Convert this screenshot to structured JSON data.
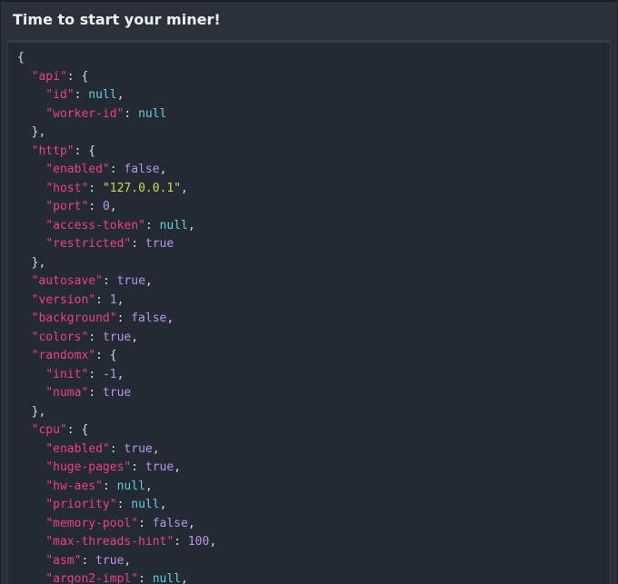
{
  "panel": {
    "title": "Time to start your miner!"
  },
  "colors": {
    "key": "#ef3f86",
    "punctuation": "#d7dce2",
    "null": "#5fd0e6",
    "boolean": "#b994f0",
    "number": "#b994f0",
    "string": "#c7e04a",
    "panel_bg": "#2a313b",
    "code_bg": "#242a33"
  },
  "config_json": {
    "lines": [
      {
        "indent": 0,
        "tokens": [
          {
            "t": "punc",
            "v": "{"
          }
        ]
      },
      {
        "indent": 1,
        "tokens": [
          {
            "t": "key",
            "v": "\"api\""
          },
          {
            "t": "punc",
            "v": ": {"
          }
        ]
      },
      {
        "indent": 2,
        "tokens": [
          {
            "t": "key",
            "v": "\"id\""
          },
          {
            "t": "punc",
            "v": ": "
          },
          {
            "t": "null",
            "v": "null"
          },
          {
            "t": "punc",
            "v": ","
          }
        ]
      },
      {
        "indent": 2,
        "tokens": [
          {
            "t": "key",
            "v": "\"worker-id\""
          },
          {
            "t": "punc",
            "v": ": "
          },
          {
            "t": "null",
            "v": "null"
          }
        ]
      },
      {
        "indent": 1,
        "tokens": [
          {
            "t": "punc",
            "v": "},"
          }
        ]
      },
      {
        "indent": 1,
        "tokens": [
          {
            "t": "key",
            "v": "\"http\""
          },
          {
            "t": "punc",
            "v": ": {"
          }
        ]
      },
      {
        "indent": 2,
        "tokens": [
          {
            "t": "key",
            "v": "\"enabled\""
          },
          {
            "t": "punc",
            "v": ": "
          },
          {
            "t": "bool",
            "v": "false"
          },
          {
            "t": "punc",
            "v": ","
          }
        ]
      },
      {
        "indent": 2,
        "tokens": [
          {
            "t": "key",
            "v": "\"host\""
          },
          {
            "t": "punc",
            "v": ": "
          },
          {
            "t": "str",
            "v": "\"127.0.0.1\""
          },
          {
            "t": "punc",
            "v": ","
          }
        ]
      },
      {
        "indent": 2,
        "tokens": [
          {
            "t": "key",
            "v": "\"port\""
          },
          {
            "t": "punc",
            "v": ": "
          },
          {
            "t": "num",
            "v": "0"
          },
          {
            "t": "punc",
            "v": ","
          }
        ]
      },
      {
        "indent": 2,
        "tokens": [
          {
            "t": "key",
            "v": "\"access-token\""
          },
          {
            "t": "punc",
            "v": ": "
          },
          {
            "t": "null",
            "v": "null"
          },
          {
            "t": "punc",
            "v": ","
          }
        ]
      },
      {
        "indent": 2,
        "tokens": [
          {
            "t": "key",
            "v": "\"restricted\""
          },
          {
            "t": "punc",
            "v": ": "
          },
          {
            "t": "bool",
            "v": "true"
          }
        ]
      },
      {
        "indent": 1,
        "tokens": [
          {
            "t": "punc",
            "v": "},"
          }
        ]
      },
      {
        "indent": 1,
        "tokens": [
          {
            "t": "key",
            "v": "\"autosave\""
          },
          {
            "t": "punc",
            "v": ": "
          },
          {
            "t": "bool",
            "v": "true"
          },
          {
            "t": "punc",
            "v": ","
          }
        ]
      },
      {
        "indent": 1,
        "tokens": [
          {
            "t": "key",
            "v": "\"version\""
          },
          {
            "t": "punc",
            "v": ": "
          },
          {
            "t": "num",
            "v": "1"
          },
          {
            "t": "punc",
            "v": ","
          }
        ]
      },
      {
        "indent": 1,
        "tokens": [
          {
            "t": "key",
            "v": "\"background\""
          },
          {
            "t": "punc",
            "v": ": "
          },
          {
            "t": "bool",
            "v": "false"
          },
          {
            "t": "punc",
            "v": ","
          }
        ]
      },
      {
        "indent": 1,
        "tokens": [
          {
            "t": "key",
            "v": "\"colors\""
          },
          {
            "t": "punc",
            "v": ": "
          },
          {
            "t": "bool",
            "v": "true"
          },
          {
            "t": "punc",
            "v": ","
          }
        ]
      },
      {
        "indent": 1,
        "tokens": [
          {
            "t": "key",
            "v": "\"randomx\""
          },
          {
            "t": "punc",
            "v": ": {"
          }
        ]
      },
      {
        "indent": 2,
        "tokens": [
          {
            "t": "key",
            "v": "\"init\""
          },
          {
            "t": "punc",
            "v": ": "
          },
          {
            "t": "num",
            "v": "-1"
          },
          {
            "t": "punc",
            "v": ","
          }
        ]
      },
      {
        "indent": 2,
        "tokens": [
          {
            "t": "key",
            "v": "\"numa\""
          },
          {
            "t": "punc",
            "v": ": "
          },
          {
            "t": "bool",
            "v": "true"
          }
        ]
      },
      {
        "indent": 1,
        "tokens": [
          {
            "t": "punc",
            "v": "},"
          }
        ]
      },
      {
        "indent": 1,
        "tokens": [
          {
            "t": "key",
            "v": "\"cpu\""
          },
          {
            "t": "punc",
            "v": ": {"
          }
        ]
      },
      {
        "indent": 2,
        "tokens": [
          {
            "t": "key",
            "v": "\"enabled\""
          },
          {
            "t": "punc",
            "v": ": "
          },
          {
            "t": "bool",
            "v": "true"
          },
          {
            "t": "punc",
            "v": ","
          }
        ]
      },
      {
        "indent": 2,
        "tokens": [
          {
            "t": "key",
            "v": "\"huge-pages\""
          },
          {
            "t": "punc",
            "v": ": "
          },
          {
            "t": "bool",
            "v": "true"
          },
          {
            "t": "punc",
            "v": ","
          }
        ]
      },
      {
        "indent": 2,
        "tokens": [
          {
            "t": "key",
            "v": "\"hw-aes\""
          },
          {
            "t": "punc",
            "v": ": "
          },
          {
            "t": "null",
            "v": "null"
          },
          {
            "t": "punc",
            "v": ","
          }
        ]
      },
      {
        "indent": 2,
        "tokens": [
          {
            "t": "key",
            "v": "\"priority\""
          },
          {
            "t": "punc",
            "v": ": "
          },
          {
            "t": "null",
            "v": "null"
          },
          {
            "t": "punc",
            "v": ","
          }
        ]
      },
      {
        "indent": 2,
        "tokens": [
          {
            "t": "key",
            "v": "\"memory-pool\""
          },
          {
            "t": "punc",
            "v": ": "
          },
          {
            "t": "bool",
            "v": "false"
          },
          {
            "t": "punc",
            "v": ","
          }
        ]
      },
      {
        "indent": 2,
        "tokens": [
          {
            "t": "key",
            "v": "\"max-threads-hint\""
          },
          {
            "t": "punc",
            "v": ": "
          },
          {
            "t": "num",
            "v": "100"
          },
          {
            "t": "punc",
            "v": ","
          }
        ]
      },
      {
        "indent": 2,
        "tokens": [
          {
            "t": "key",
            "v": "\"asm\""
          },
          {
            "t": "punc",
            "v": ": "
          },
          {
            "t": "bool",
            "v": "true"
          },
          {
            "t": "punc",
            "v": ","
          }
        ]
      },
      {
        "indent": 2,
        "tokens": [
          {
            "t": "key",
            "v": "\"argon2-impl\""
          },
          {
            "t": "punc",
            "v": ": "
          },
          {
            "t": "null",
            "v": "null"
          },
          {
            "t": "punc",
            "v": ","
          }
        ]
      }
    ]
  }
}
